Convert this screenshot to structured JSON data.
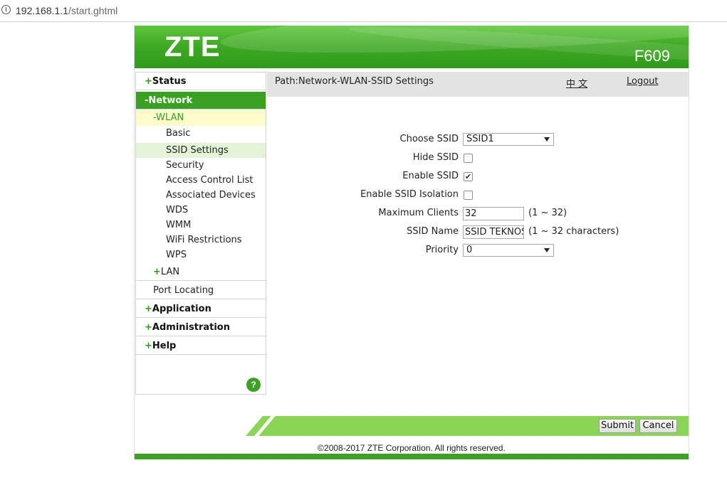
{
  "browser": {
    "url_host": "192.168.1.1",
    "url_path": "/start.ghtml"
  },
  "header": {
    "logo": "ZTE",
    "model": "F609"
  },
  "sidebar": {
    "status": {
      "sign": "+",
      "label": "Status"
    },
    "network": {
      "sign": "-",
      "label": "Network"
    },
    "wlan": {
      "sign": "-",
      "label": "WLAN"
    },
    "wlan_items": [
      "Basic",
      "SSID Settings",
      "Security",
      "Access Control List",
      "Associated Devices",
      "WDS",
      "WMM",
      "WiFi Restrictions",
      "WPS"
    ],
    "lan": {
      "sign": "+",
      "label": "LAN"
    },
    "port_locating": "Port Locating",
    "application": {
      "sign": "+",
      "label": "Application"
    },
    "administration": {
      "sign": "+",
      "label": "Administration"
    },
    "help": {
      "sign": "+",
      "label": "Help"
    },
    "help_icon": "?"
  },
  "pathbar": {
    "path": "Path:Network-WLAN-SSID Settings",
    "language": "中 文",
    "logout": "Logout"
  },
  "form": {
    "choose_ssid": {
      "label": "Choose SSID",
      "value": "SSID1"
    },
    "hide_ssid": {
      "label": "Hide SSID",
      "checked": false
    },
    "enable_ssid": {
      "label": "Enable SSID",
      "checked": true,
      "mark": "✔"
    },
    "enable_isolation": {
      "label": "Enable SSID Isolation",
      "checked": false
    },
    "max_clients": {
      "label": "Maximum Clients",
      "value": "32",
      "hint": "(1 ~ 32)"
    },
    "ssid_name": {
      "label": "SSID Name",
      "value": "SSID TEKNOS",
      "hint": "(1 ~ 32 characters)"
    },
    "priority": {
      "label": "Priority",
      "value": "0"
    }
  },
  "buttons": {
    "submit": "Submit",
    "cancel": "Cancel"
  },
  "footer": {
    "copyright": "©2008-2017 ZTE Corporation. All rights reserved."
  },
  "colors": {
    "brand_green": "#3ea126",
    "active_menu": "#3aa021",
    "wlan_highlight": "#fffccc",
    "selected_item": "#e2f3d7",
    "bottom_bar": "#8ad556"
  }
}
